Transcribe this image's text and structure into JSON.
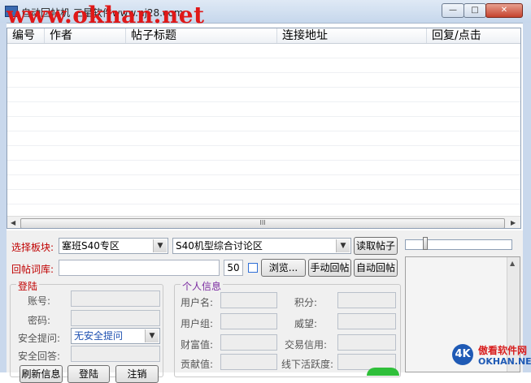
{
  "window": {
    "title": "自动回帖机 三星软件www.nj28.com",
    "watermark": "www.okhan.net",
    "minimize_label": "—",
    "maximize_label": "□",
    "close_label": "✕"
  },
  "list": {
    "columns": [
      "编号",
      "作者",
      "帖子标题",
      "连接地址",
      "回复/点击"
    ],
    "scroll_left": "◀",
    "scroll_right": "▶",
    "scroll_thumb": "III"
  },
  "board": {
    "label": "选择板块:",
    "combo1_value": "塞班S40专区",
    "combo2_value": "S40机型综合讨论区",
    "read_button": "读取帖子"
  },
  "reply": {
    "label": "回帖词库:",
    "input_value": "",
    "count_value": "50",
    "browse_button": "浏览...",
    "manual_button": "手动回帖",
    "auto_button": "自动回帖"
  },
  "progress": {
    "value": 0.0
  },
  "login": {
    "group_title": "登陆",
    "account_label": "账号:",
    "password_label": "密码:",
    "question_label": "安全提问:",
    "question_value": "无安全提问",
    "answer_label": "安全回答:",
    "refresh_button": "刷新信息",
    "login_button": "登陆",
    "logout_button": "注销"
  },
  "profile": {
    "group_title": "个人信息",
    "username_label": "用户名:",
    "usergroup_label": "用户组:",
    "wealth_label": "财富值:",
    "contribution_label": "贡献值:",
    "points_label": "积分:",
    "prestige_label": "威望:",
    "trade_label": "交易信用:",
    "offline_label": "线下活跃度:"
  },
  "logo": {
    "mark": "4K",
    "name": "傲看软件网",
    "url": "OKHAN.NET"
  },
  "colors": {
    "accent_red": "#c00000",
    "login_title": "#c00000",
    "profile_title": "#7a2aa0"
  }
}
